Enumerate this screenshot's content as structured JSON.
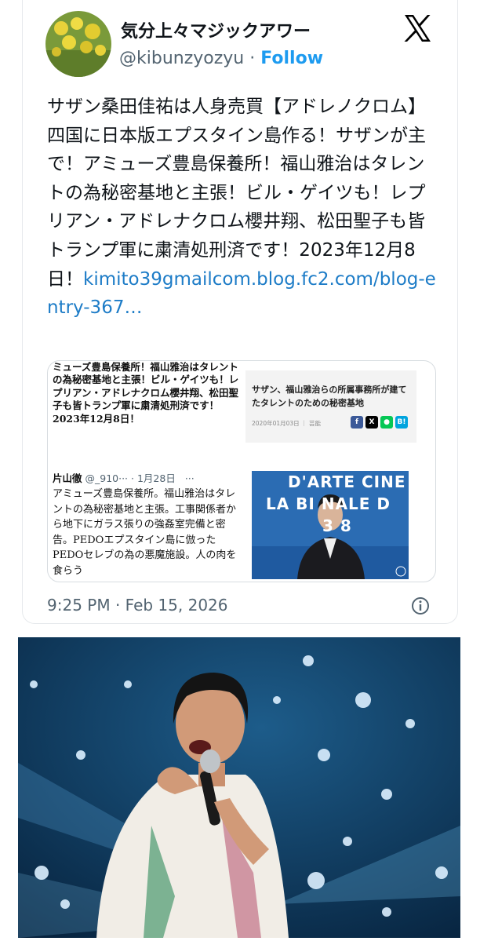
{
  "tweet": {
    "display_name": "気分上々マジックアワー",
    "handle": "@kibunzyozyu",
    "separator": "·",
    "follow_label": "Follow",
    "body_text": "サザン桑田佳祐は人身売買【アドレノクロム】四国に日本版エプスタイン島作る！サザンが主で！アミューズ豊島保養所！福山雅治はタレントの為秘密基地と主張！ビル・ゲイツも！レプリアン・アドレナクロム櫻井翔、松田聖子も皆トランプ軍に粛清処刑済です！2023年12月8日！",
    "body_link": "kimito39gmailcom.blog.fc2.com/blog-entry-367…",
    "timestamp": "9:25 PM · Feb 15, 2026",
    "icons": {
      "logo": "x-logo-icon",
      "info": "info-icon"
    }
  },
  "embed": {
    "quoted_text": "ミューズ豊島保養所！福山雅治はタレントの為秘密基地と主張！ビル・ゲイツも！レプリアン・アドレナクロム櫻井翔、松田聖子も皆トランプ軍に粛清処刑済です！2023年12月8日！",
    "reply_name": "片山徹",
    "reply_handle": "@_910···",
    "reply_date": "· 1月28日",
    "reply_more": "···",
    "reply_text": "アミューズ豊島保養所。福山雅治はタレントの為秘密基地と主張。工事関係者から地下にガラス張りの強姦室完備と密告。PEDOエプスタイン島に倣ったPEDOセレブの為の悪魔施設。人の肉を食らう",
    "article_title": "サザン、福山雅治らの所属事務所が建てたタレントのための秘密基地",
    "article_meta": "2020年01月03日 ｜ 芸能",
    "share_f": "f",
    "share_x": "X",
    "share_line": "●",
    "share_b": "B!",
    "photo_sign_1": "D'ARTE CINE",
    "photo_sign_2": "LA BI NALE D",
    "photo_sign_3": "3 8"
  },
  "colors": {
    "link": "#1d9bf0",
    "secondary_text": "#536471"
  }
}
